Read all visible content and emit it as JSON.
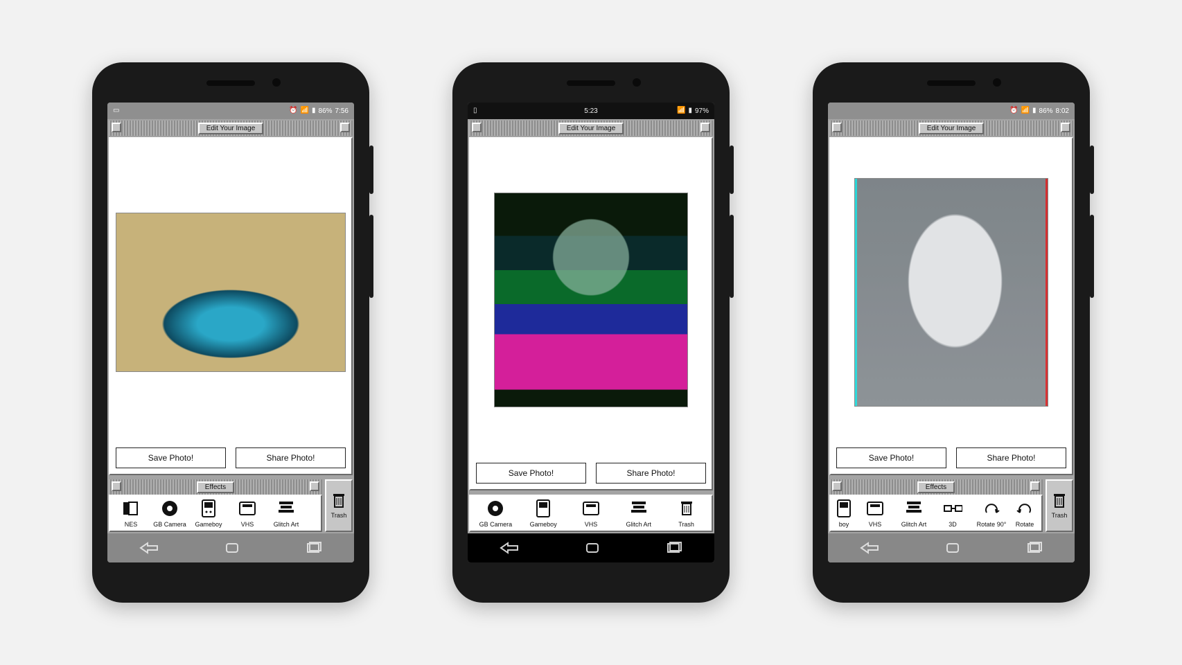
{
  "phones": [
    {
      "statusbar": {
        "battery": "86%",
        "time": "7:56",
        "center": "",
        "style": "light",
        "icons_left": [
          "card"
        ],
        "icons_right": [
          "alarm",
          "wifi",
          "battery"
        ]
      },
      "edit_title": "Edit Your Image",
      "save_label": "Save Photo!",
      "share_label": "Share Photo!",
      "effects_title": "Effects",
      "effects": [
        {
          "id": "nes",
          "label": "NES",
          "icon": "nes"
        },
        {
          "id": "gbcamera",
          "label": "GB Camera",
          "icon": "disc"
        },
        {
          "id": "gameboy",
          "label": "Gameboy",
          "icon": "gameboy"
        },
        {
          "id": "vhs",
          "label": "VHS",
          "icon": "vhs"
        },
        {
          "id": "glitchart",
          "label": "Glitch Art",
          "icon": "glitch"
        }
      ],
      "trash_label": "Trash",
      "image": "pool"
    },
    {
      "statusbar": {
        "battery": "97%",
        "time": "",
        "center": "5:23",
        "style": "dark",
        "icons_left": [
          "card"
        ],
        "icons_right": [
          "wifi",
          "battery"
        ]
      },
      "edit_title": "Edit Your Image",
      "save_label": "Save Photo!",
      "share_label": "Share Photo!",
      "effects_title": "Effects",
      "effects": [
        {
          "id": "gbcamera",
          "label": "GB Camera",
          "icon": "disc"
        },
        {
          "id": "gameboy",
          "label": "Gameboy",
          "icon": "gameboy"
        },
        {
          "id": "vhs",
          "label": "VHS",
          "icon": "vhs"
        },
        {
          "id": "glitchart",
          "label": "Glitch Art",
          "icon": "glitch"
        },
        {
          "id": "trash-inline",
          "label": "Trash",
          "icon": "trash"
        }
      ],
      "trash_label": "",
      "image": "glitch"
    },
    {
      "statusbar": {
        "battery": "86%",
        "time": "8:02",
        "center": "",
        "style": "light",
        "icons_left": [],
        "icons_right": [
          "alarm",
          "wifi",
          "battery"
        ]
      },
      "edit_title": "Edit Your Image",
      "save_label": "Save Photo!",
      "share_label": "Share Photo!",
      "effects_title": "Effects",
      "effects": [
        {
          "id": "gameboy-partial",
          "label": "boy",
          "icon": "gameboy"
        },
        {
          "id": "vhs",
          "label": "VHS",
          "icon": "vhs"
        },
        {
          "id": "glitchart",
          "label": "Glitch Art",
          "icon": "glitch"
        },
        {
          "id": "3d",
          "label": "3D",
          "icon": "threeD"
        },
        {
          "id": "rotate90",
          "label": "Rotate 90°",
          "icon": "rotate"
        },
        {
          "id": "rotate-partial",
          "label": "Rotate",
          "icon": "rotate2"
        }
      ],
      "trash_label": "Trash",
      "image": "anaglyph"
    }
  ]
}
